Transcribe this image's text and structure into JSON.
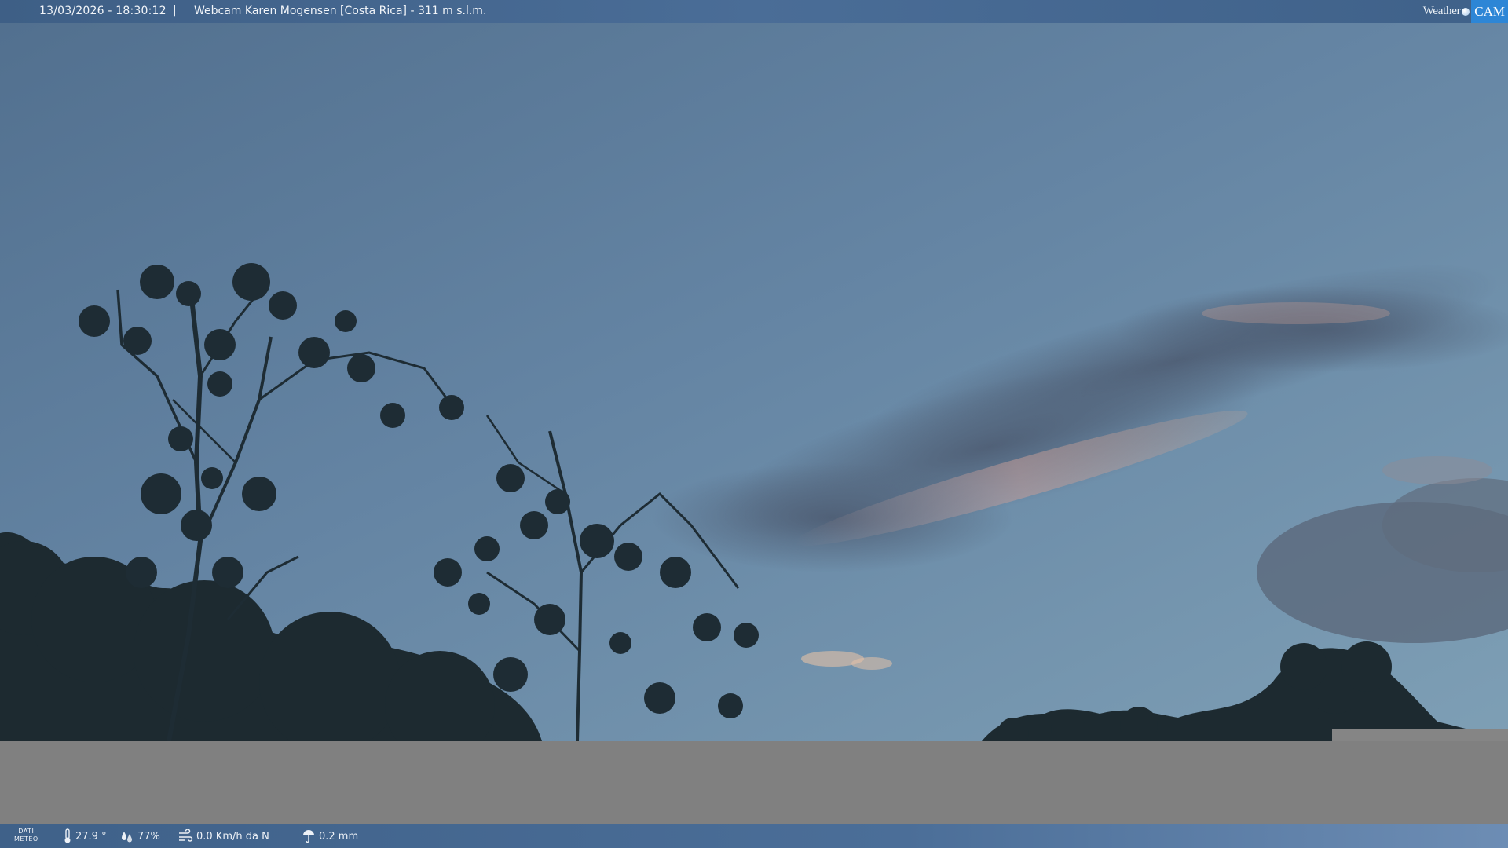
{
  "header": {
    "datetime": "13/03/2026 - 18:30:12",
    "separator": "|",
    "title": "Webcam Karen Mogensen [Costa Rica]  - 311 m s.l.m.",
    "brand_word": "Weather",
    "brand_cam": "CAM",
    "brand_accent_color": "#2d86d6"
  },
  "footer": {
    "dati_label_line1": "DATI",
    "dati_label_line2": "METEO",
    "temperature": "27.9 °",
    "temperature_icon": "thermometer-icon",
    "humidity": "77%",
    "humidity_icon": "water-drops-icon",
    "wind": "0.0 Km/h da N",
    "wind_icon": "wind-icon",
    "rain": "0.2 mm",
    "rain_icon": "rain-umbrella-icon"
  }
}
